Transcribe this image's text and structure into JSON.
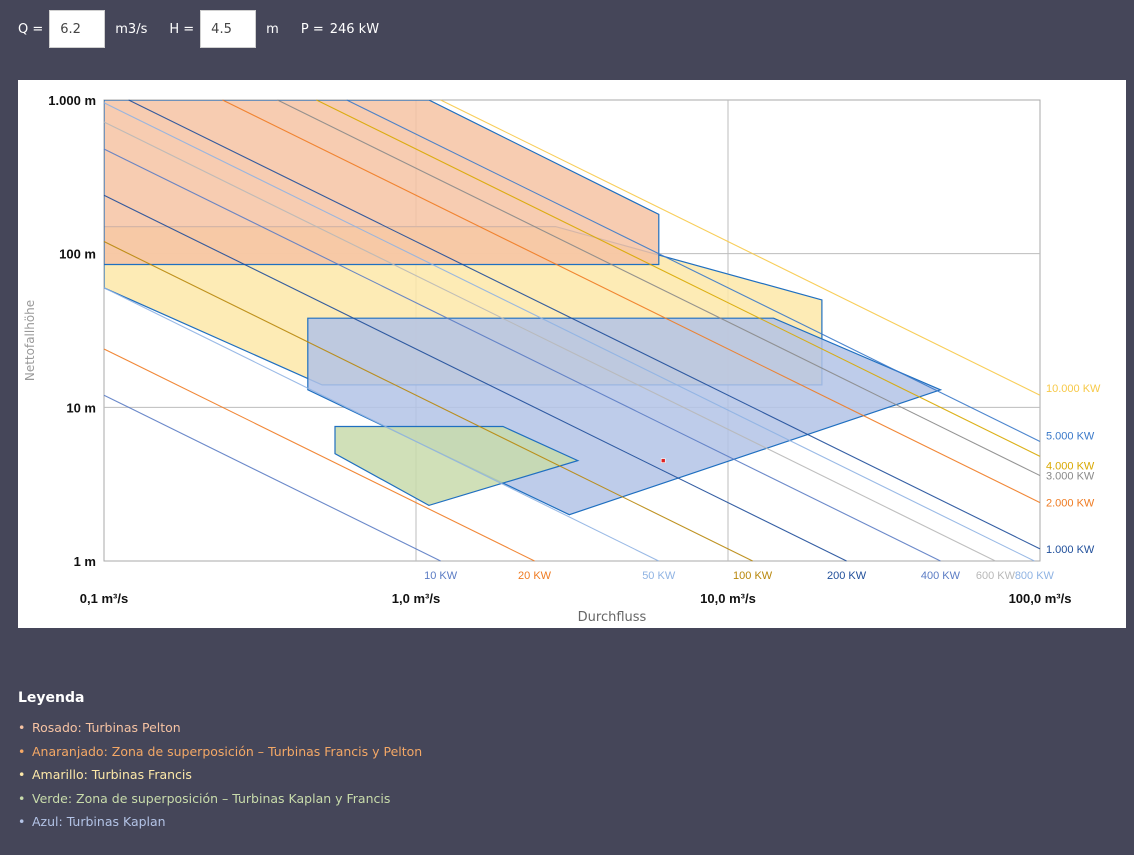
{
  "controls": {
    "q_label": "Q =",
    "q_value": "6.2",
    "q_unit": "m3/s",
    "h_label": "H =",
    "h_value": "4.5",
    "h_unit": "m",
    "p_label": "P =",
    "p_value": "246 kW"
  },
  "chart_data": {
    "type": "area",
    "xlabel": "Durchfluss",
    "ylabel": "Nettofallhöhe",
    "x_scale": "log",
    "y_scale": "log",
    "xlim": [
      0.1,
      100
    ],
    "ylim": [
      1,
      1000
    ],
    "x_ticks": [
      {
        "value": 0.1,
        "label": "0,1 m³/s"
      },
      {
        "value": 1,
        "label": "1,0 m³/s"
      },
      {
        "value": 10,
        "label": "10,0 m³/s"
      },
      {
        "value": 100,
        "label": "100,0 m³/s"
      }
    ],
    "y_ticks": [
      {
        "value": 1,
        "label": "1 m"
      },
      {
        "value": 10,
        "label": "10 m"
      },
      {
        "value": 100,
        "label": "100 m"
      },
      {
        "value": 1000,
        "label": "1.000 m"
      }
    ],
    "power_lines": [
      {
        "kw": 10,
        "label": "10 KW",
        "color": "#5b7cc4"
      },
      {
        "kw": 20,
        "label": "20 KW",
        "color": "#ef7b22"
      },
      {
        "kw": 50,
        "label": "50 KW",
        "color": "#8fb3e3"
      },
      {
        "kw": 100,
        "label": "100 KW",
        "color": "#b8870b"
      },
      {
        "kw": 200,
        "label": "200 KW",
        "color": "#1f4e9a"
      },
      {
        "kw": 400,
        "label": "400 KW",
        "color": "#5b7cc4"
      },
      {
        "kw": 600,
        "label": "600 KW",
        "color": "#b8b8b8"
      },
      {
        "kw": 800,
        "label": "800 KW",
        "color": "#8fb3e3"
      },
      {
        "kw": 1000,
        "label": "1.000 KW",
        "color": "#1f4e9a"
      },
      {
        "kw": 2000,
        "label": "2.000 KW",
        "color": "#ef7b22"
      },
      {
        "kw": 3000,
        "label": "3.000 KW",
        "color": "#8a8a8a"
      },
      {
        "kw": 4000,
        "label": "4.000 KW",
        "color": "#d8a800"
      },
      {
        "kw": 5000,
        "label": "5.000 KW",
        "color": "#3a79c9"
      },
      {
        "kw": 10000,
        "label": "10.000 KW",
        "color": "#f7c948"
      }
    ],
    "zones": [
      {
        "name": "Francis",
        "fill": "#fde8a8",
        "stroke": "#1f6fc0",
        "points": [
          [
            0.1,
            150
          ],
          [
            2.8,
            150
          ],
          [
            20,
            50
          ],
          [
            20,
            14
          ],
          [
            0.5,
            14
          ],
          [
            0.1,
            60
          ]
        ]
      },
      {
        "name": "Pelton",
        "fill": "#f6c3a3",
        "stroke": "#1f6fc0",
        "points": [
          [
            0.1,
            1000
          ],
          [
            1.1,
            1000
          ],
          [
            6,
            180
          ],
          [
            6,
            85
          ],
          [
            0.1,
            85
          ]
        ]
      },
      {
        "name": "Kaplan",
        "fill": "#b3c3e6",
        "stroke": "#1f6fc0",
        "points": [
          [
            0.45,
            38
          ],
          [
            14,
            38
          ],
          [
            48,
            13
          ],
          [
            3.1,
            2
          ],
          [
            0.45,
            13
          ]
        ]
      },
      {
        "name": "Kaplan-Francis overlap",
        "fill": "#c8dbab",
        "stroke": "#1f6fc0",
        "points": [
          [
            0.55,
            7.5
          ],
          [
            1.9,
            7.5
          ],
          [
            3.3,
            4.5
          ],
          [
            1.1,
            2.3
          ],
          [
            0.55,
            5
          ]
        ]
      }
    ],
    "marker": {
      "x": 6.2,
      "y": 4.5,
      "color": "#e02020"
    }
  },
  "legend": {
    "title": "Leyenda",
    "items": [
      {
        "text": "Rosado: Turbinas Pelton",
        "color": "#f6c3a3"
      },
      {
        "text": "Anaranjado: Zona de superposición – Turbinas Francis y Pelton",
        "color": "#f4a866"
      },
      {
        "text": "Amarillo: Turbinas Francis",
        "color": "#fde8a8"
      },
      {
        "text": "Verde: Zona de superposición – Turbinas Kaplan y Francis",
        "color": "#c8dbab"
      },
      {
        "text": "Azul: Turbinas Kaplan",
        "color": "#b3c3e6"
      }
    ]
  }
}
